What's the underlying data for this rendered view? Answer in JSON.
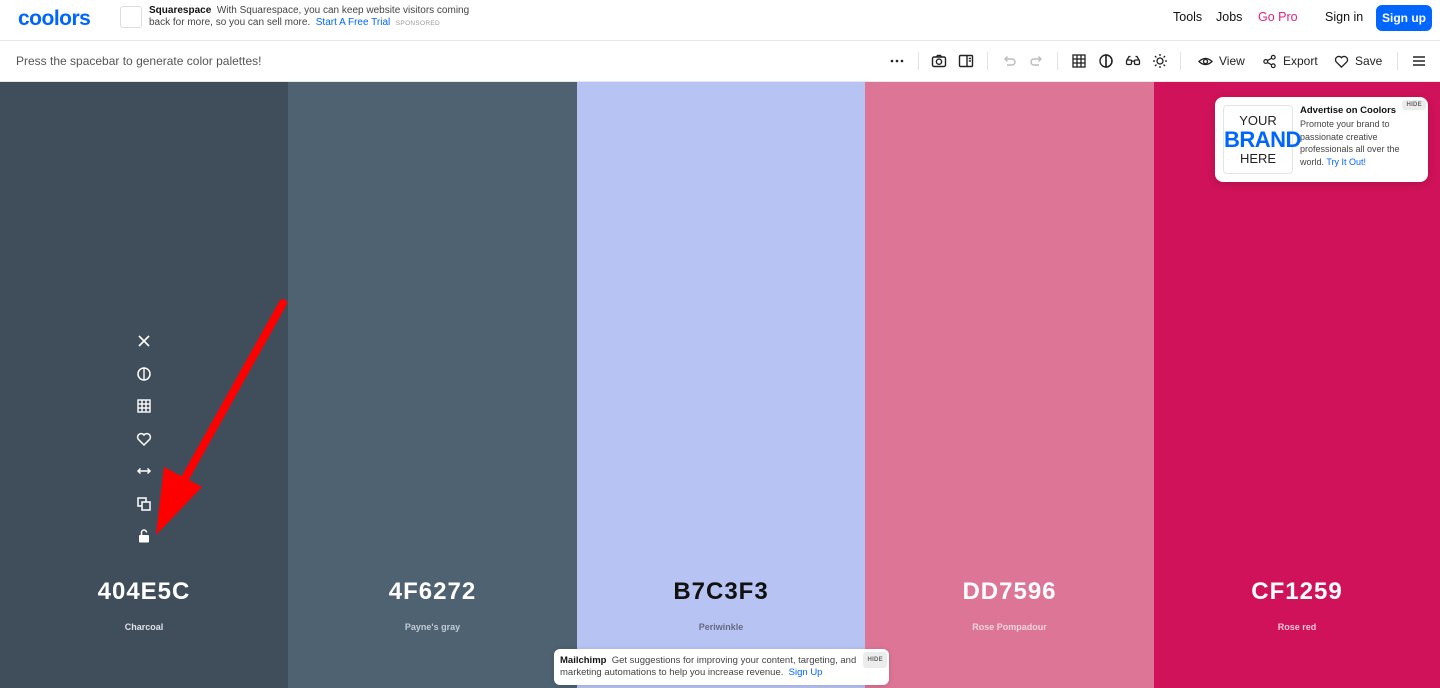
{
  "topbar": {
    "logo": "coolors",
    "ad": {
      "brand": "Squarespace",
      "text": "With Squarespace, you can keep website visitors coming back for more, so you can sell more.",
      "cta": "Start A Free Trial",
      "sponsored": "SPONSORED"
    },
    "nav": {
      "tools": "Tools",
      "jobs": "Jobs",
      "gopro": "Go Pro",
      "signin": "Sign in",
      "signup": "Sign up"
    }
  },
  "toolbar": {
    "hint": "Press the spacebar to generate color palettes!",
    "view_label": "View",
    "export_label": "Export",
    "save_label": "Save",
    "icons": [
      "more-icon",
      "camera-icon",
      "sidebar-icon",
      "undo-icon",
      "redo-icon",
      "grid-icon",
      "contrast-icon",
      "glasses-icon",
      "sun-icon",
      "eye-icon",
      "share-icon",
      "heart-icon",
      "menu-icon"
    ]
  },
  "palette": {
    "colors": [
      {
        "hex": "404E5C",
        "name": "Charcoal",
        "bg": "#404E5C",
        "fg": "#ffffff",
        "sub": "#dfe2e6"
      },
      {
        "hex": "4F6272",
        "name": "Payne's gray",
        "bg": "#4F6272",
        "fg": "#ffffff",
        "sub": "#c3ccd4"
      },
      {
        "hex": "B7C3F3",
        "name": "Periwinkle",
        "bg": "#B7C3F3",
        "fg": "#111111",
        "sub": "#666a80"
      },
      {
        "hex": "DD7596",
        "name": "Rose Pompadour",
        "bg": "#DD7596",
        "fg": "#ffffff",
        "sub": "#f4d4de"
      },
      {
        "hex": "CF1259",
        "name": "Rose red",
        "bg": "#CF1259",
        "fg": "#ffffff",
        "sub": "#f0c6d5"
      }
    ],
    "column_tools": [
      "close-icon",
      "contrast-icon",
      "grid-icon",
      "heart-icon",
      "drag-icon",
      "copy-icon",
      "lock-icon"
    ]
  },
  "ad_card": {
    "brand_l1": "YOUR",
    "brand_l2": "BRAND",
    "brand_l3": "HERE",
    "title": "Advertise on Coolors",
    "desc": "Promote your brand to passionate creative professionals all over the world.",
    "cta": "Try It Out!",
    "hide": "HIDE"
  },
  "bottom_ad": {
    "brand": "Mailchimp",
    "text": "Get suggestions for improving your content, targeting, and marketing automations to help you increase revenue.",
    "cta": "Sign Up",
    "hide": "HIDE"
  },
  "annotation": {
    "color": "#ff0000"
  }
}
